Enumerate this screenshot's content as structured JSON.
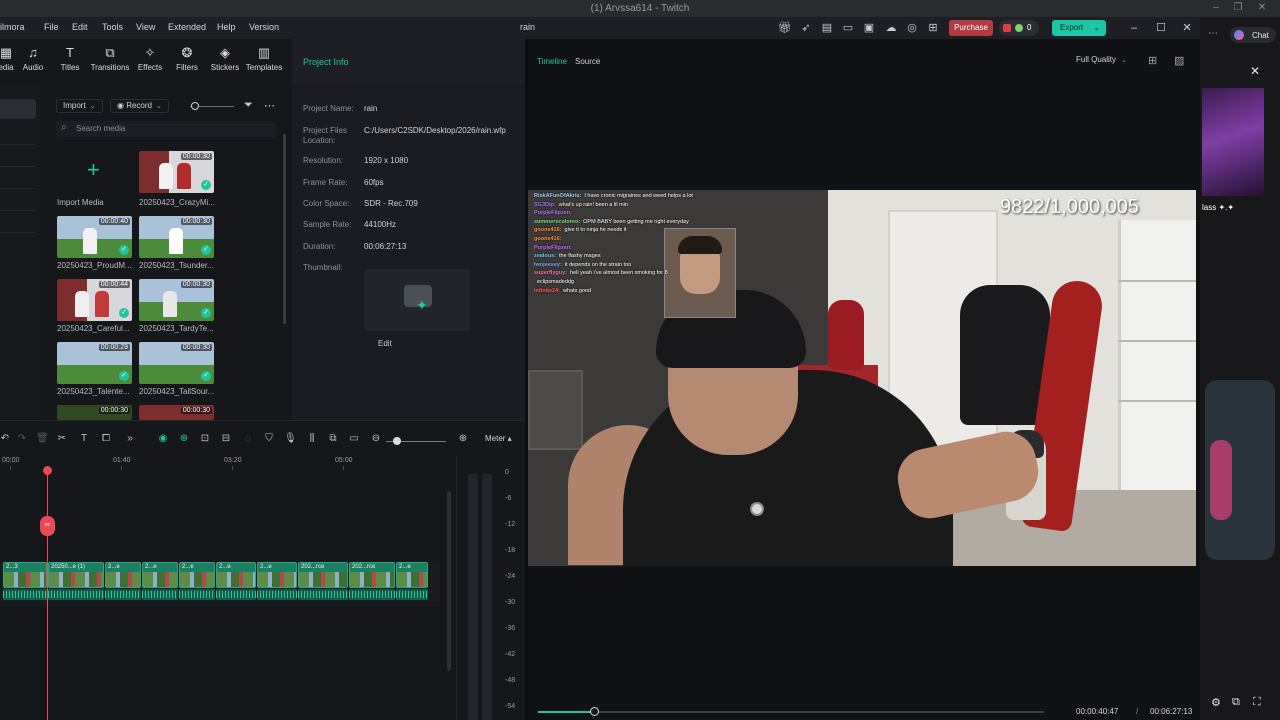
{
  "browser": {
    "tab_title": "(1) Arvssa614 - Twitch"
  },
  "app": {
    "name_fragment": "ilmora",
    "project_title": "rain",
    "menu": [
      "File",
      "Edit",
      "Tools",
      "View",
      "Extended",
      "Help",
      "Version"
    ],
    "purchase_label": "Purchase",
    "credits_count": "0",
    "export_label": "Export"
  },
  "toolbar": {
    "items": [
      {
        "label": "edia",
        "icon": "media-icon"
      },
      {
        "label": "Audio",
        "icon": "music-note-icon"
      },
      {
        "label": "Titles",
        "icon": "text-icon"
      },
      {
        "label": "Transitions",
        "icon": "transitions-icon"
      },
      {
        "label": "Effects",
        "icon": "effects-icon"
      },
      {
        "label": "Filters",
        "icon": "filters-icon"
      },
      {
        "label": "Stickers",
        "icon": "stickers-icon"
      },
      {
        "label": "Templates",
        "icon": "templates-icon"
      }
    ]
  },
  "media": {
    "import_label": "Import",
    "record_label": "Record",
    "search_placeholder": "Search media",
    "import_media_label": "Import Media",
    "clips": [
      {
        "name": "20250423_CrazyMi...",
        "duration": "00:00:30",
        "scene": "room"
      },
      {
        "name": "20250423_ProudM...",
        "duration": "00:00:40",
        "scene": "field"
      },
      {
        "name": "20250423_Tsunder...",
        "duration": "00:00:30",
        "scene": "field"
      },
      {
        "name": "20250423_Careful...",
        "duration": "00:00:44",
        "scene": "room"
      },
      {
        "name": "20250423_TardyTe...",
        "duration": "00:00:30",
        "scene": "field"
      },
      {
        "name": "20250423_Talente...",
        "duration": "00:00:29",
        "scene": "field"
      },
      {
        "name": "20250423_TallSour...",
        "duration": "00:00:30",
        "scene": "field"
      },
      {
        "name": "",
        "duration": "00:00:30",
        "scene": "dark"
      },
      {
        "name": "",
        "duration": "00:00:30",
        "scene": "room"
      }
    ]
  },
  "project_info": {
    "header": "Project Info",
    "rows": [
      {
        "label": "Project Name:",
        "value": "rain"
      },
      {
        "label": "Project Files Location:",
        "value": "C:/Users/C2SDK/Desktop/2026/rain.wfp"
      },
      {
        "label": "Resolution:",
        "value": "1920 x 1080"
      },
      {
        "label": "Frame Rate:",
        "value": "60fps"
      },
      {
        "label": "Color Space:",
        "value": "SDR - Rec.709"
      },
      {
        "label": "Sample Rate:",
        "value": "44100Hz"
      },
      {
        "label": "Duration:",
        "value": "00:06:27:13"
      },
      {
        "label": "Thumbnail:",
        "value": ""
      }
    ],
    "edit_label": "Edit"
  },
  "preview": {
    "tab_timeline": "Timeline",
    "tab_source": "Source",
    "quality": "Full Quality",
    "sub_counter": "9822/1,000,005",
    "current_time": "00:00:40:47",
    "separator": "/",
    "total_time": "00:06:27:13",
    "progress_fraction": 0.11,
    "chat": [
      {
        "user": "RiskAFunOfAkris:",
        "msg": "I have cronic migraines and weed helps a lot",
        "color": "#9ed0ff"
      },
      {
        "user": "SG3Dip:",
        "msg": "what's up rain! been a lil min",
        "color": "#a070ff"
      },
      {
        "user": "PurpleFlipzen:",
        "msg": "",
        "color": "#c36bff"
      },
      {
        "user": "summerscoloreo:",
        "msg": "OPM BABY been getting me right everyday",
        "color": "#7ee07e"
      },
      {
        "user": "goone416:",
        "msg": "give it to ninja he needs it",
        "color": "#ff8c3b"
      },
      {
        "user": "goone416:",
        "msg": "",
        "color": "#ff8c3b"
      },
      {
        "user": "PurpleFlipzen:",
        "msg": "",
        "color": "#c36bff"
      },
      {
        "user": "zealous:",
        "msg": "the flashy mages",
        "color": "#66ccff"
      },
      {
        "user": "lwojeesey:",
        "msg": "it depends on the strain too",
        "color": "#7aa7ff"
      },
      {
        "user": "superflyguy:",
        "msg": "hell yeah i've almost been smoking for 8",
        "color": "#ff6fb1"
      },
      {
        "user": "",
        "msg": "eclipsmadeddg",
        "color": "#ffffff"
      },
      {
        "user": "infinite24:",
        "msg": "whats good",
        "color": "#ff5a5a"
      }
    ]
  },
  "timeline": {
    "ruler": [
      "00:00",
      "01:40",
      "03:20",
      "05:00"
    ],
    "clips": [
      {
        "label": "2...3",
        "w": 44
      },
      {
        "label": "20250...e (1)",
        "w": 56
      },
      {
        "label": "2...e",
        "w": 36
      },
      {
        "label": "2...e",
        "w": 36
      },
      {
        "label": "2...e",
        "w": 36
      },
      {
        "label": "2...e",
        "w": 40
      },
      {
        "label": "2...e",
        "w": 40
      },
      {
        "label": "202...rce",
        "w": 50
      },
      {
        "label": "202...rce",
        "w": 46
      },
      {
        "label": "2...e",
        "w": 32
      }
    ],
    "meter_label": "Meter",
    "meter_scale": [
      "0",
      "-6",
      "-12",
      "-18",
      "-24",
      "-30",
      "-36",
      "-42",
      "-48",
      "-54"
    ]
  },
  "twitch": {
    "chat_button": "Chat",
    "side_text": "lass ✦.✦"
  }
}
